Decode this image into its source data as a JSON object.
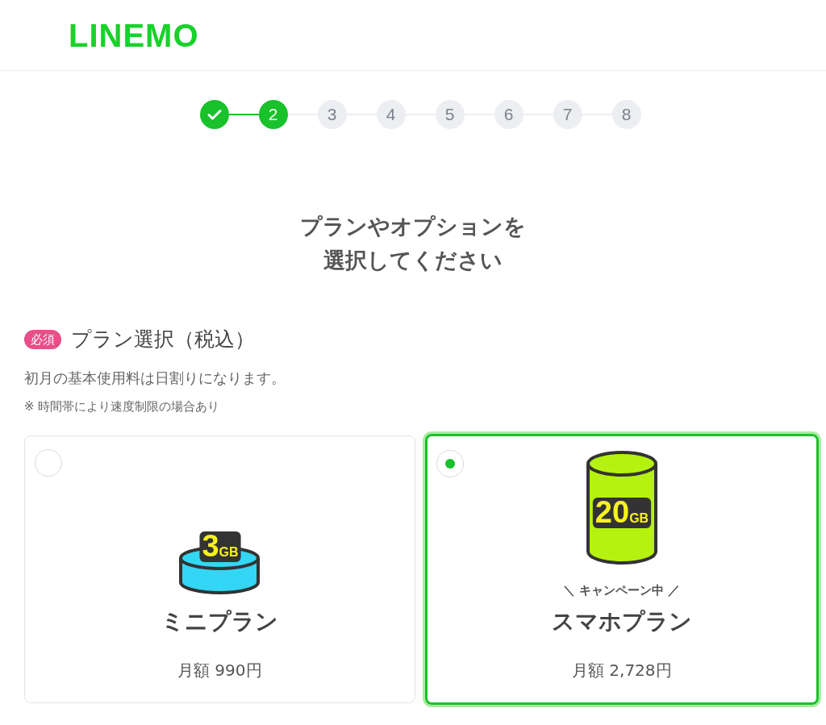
{
  "header": {
    "logo": "LINEMO"
  },
  "steps": [
    {
      "kind": "done"
    },
    {
      "kind": "current",
      "label": "2"
    },
    {
      "kind": "pending",
      "label": "3"
    },
    {
      "kind": "pending",
      "label": "4"
    },
    {
      "kind": "pending",
      "label": "5"
    },
    {
      "kind": "pending",
      "label": "6"
    },
    {
      "kind": "pending",
      "label": "7"
    },
    {
      "kind": "pending",
      "label": "8"
    }
  ],
  "title_lines": [
    "プランやオプションを",
    "選択してください"
  ],
  "section": {
    "badge": "必須",
    "heading": "プラン選択（税込）",
    "note": "初月の基本使用料は日割りになります。",
    "small_note": "※ 時間帯により速度制限の場合あり"
  },
  "plans": [
    {
      "kind": "mini",
      "capacity": "3",
      "unit": "GB",
      "name": "ミニプラン",
      "price": "月額 990円",
      "selected": false
    },
    {
      "kind": "smaho",
      "capacity": "20",
      "unit": "GB",
      "campaign": "＼ キャンペーン中 ／",
      "name": "スマホプラン",
      "price": "月額 2,728円",
      "selected": true
    }
  ]
}
